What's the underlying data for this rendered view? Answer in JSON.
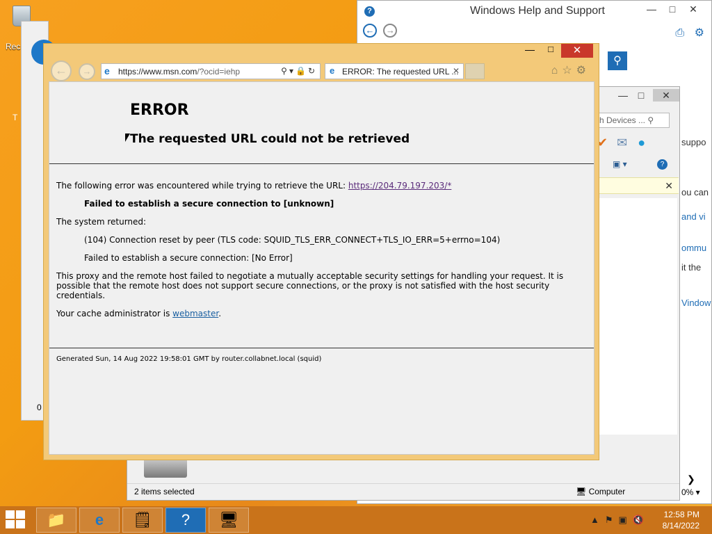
{
  "desktop": {
    "recycle_label": "Rec",
    "icon2_label": "T",
    "bg_explorer_digit": "0"
  },
  "help_window": {
    "title": "Windows Help and Support",
    "right_texts": [
      "suppo",
      "ou can",
      "and vi",
      "ommu",
      "it the",
      "Vindow"
    ]
  },
  "devices_window": {
    "search_placeholder": "rch Devices ...",
    "status_left": "2 items selected",
    "status_right": "Computer",
    "zoom": "0%"
  },
  "ie": {
    "address_url_host": "https://www.msn.com",
    "address_url_path": "/?ocid=iehp",
    "tab_title": "ERROR: The requested URL ...",
    "page": {
      "title": "ERROR",
      "subtitle": "The requested URL could not be retrieved",
      "line1_prefix": "The following error was encountered while trying to retrieve the URL: ",
      "line1_link": "https://204.79.197.203/*",
      "line2": "Failed to establish a secure connection to [unknown]",
      "line3": "The system returned:",
      "line4": "(104) Connection reset by peer (TLS code: SQUID_TLS_ERR_CONNECT+TLS_IO_ERR=5+errno=104)",
      "line5": "Failed to establish a secure connection: [No Error]",
      "line6": "This proxy and the remote host failed to negotiate a mutually acceptable security settings for handling your request. It is possible that the remote host does not support secure connections, or the proxy is not satisfied with the host security credentials.",
      "line7_prefix": "Your cache administrator is ",
      "line7_link": "webmaster",
      "line7_suffix": ".",
      "footer": "Generated Sun, 14 Aug 2022 19:58:01 GMT by router.collabnet.local (squid)"
    }
  },
  "taskbar": {
    "time": "12:58 PM",
    "date": "8/14/2022"
  },
  "colors": {
    "ie_frame": "#f3c979",
    "taskbar": "#c9731a",
    "close_red": "#c9382b",
    "help_blue": "#1f6db5"
  }
}
